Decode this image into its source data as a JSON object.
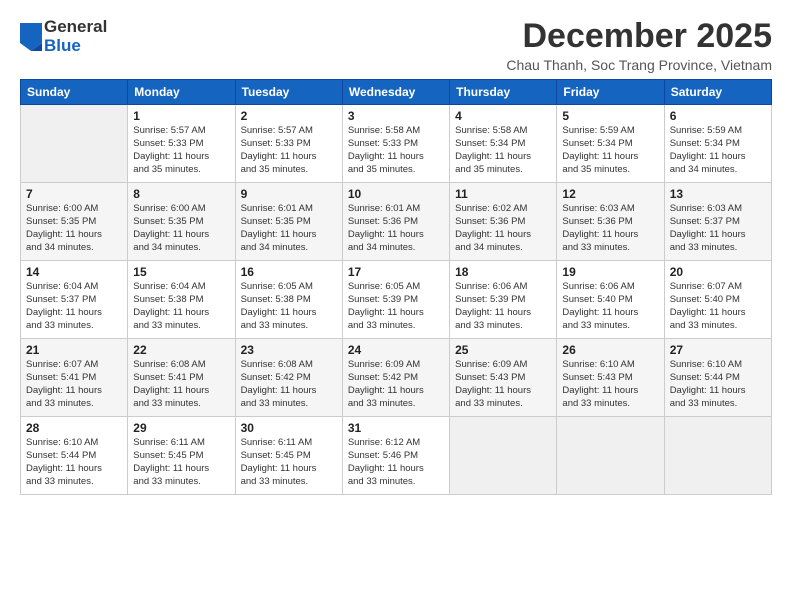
{
  "logo": {
    "general": "General",
    "blue": "Blue"
  },
  "header": {
    "month": "December 2025",
    "location": "Chau Thanh, Soc Trang Province, Vietnam"
  },
  "weekdays": [
    "Sunday",
    "Monday",
    "Tuesday",
    "Wednesday",
    "Thursday",
    "Friday",
    "Saturday"
  ],
  "weeks": [
    [
      {
        "day": "",
        "info": ""
      },
      {
        "day": "1",
        "info": "Sunrise: 5:57 AM\nSunset: 5:33 PM\nDaylight: 11 hours\nand 35 minutes."
      },
      {
        "day": "2",
        "info": "Sunrise: 5:57 AM\nSunset: 5:33 PM\nDaylight: 11 hours\nand 35 minutes."
      },
      {
        "day": "3",
        "info": "Sunrise: 5:58 AM\nSunset: 5:33 PM\nDaylight: 11 hours\nand 35 minutes."
      },
      {
        "day": "4",
        "info": "Sunrise: 5:58 AM\nSunset: 5:34 PM\nDaylight: 11 hours\nand 35 minutes."
      },
      {
        "day": "5",
        "info": "Sunrise: 5:59 AM\nSunset: 5:34 PM\nDaylight: 11 hours\nand 35 minutes."
      },
      {
        "day": "6",
        "info": "Sunrise: 5:59 AM\nSunset: 5:34 PM\nDaylight: 11 hours\nand 34 minutes."
      }
    ],
    [
      {
        "day": "7",
        "info": "Sunrise: 6:00 AM\nSunset: 5:35 PM\nDaylight: 11 hours\nand 34 minutes."
      },
      {
        "day": "8",
        "info": "Sunrise: 6:00 AM\nSunset: 5:35 PM\nDaylight: 11 hours\nand 34 minutes."
      },
      {
        "day": "9",
        "info": "Sunrise: 6:01 AM\nSunset: 5:35 PM\nDaylight: 11 hours\nand 34 minutes."
      },
      {
        "day": "10",
        "info": "Sunrise: 6:01 AM\nSunset: 5:36 PM\nDaylight: 11 hours\nand 34 minutes."
      },
      {
        "day": "11",
        "info": "Sunrise: 6:02 AM\nSunset: 5:36 PM\nDaylight: 11 hours\nand 34 minutes."
      },
      {
        "day": "12",
        "info": "Sunrise: 6:03 AM\nSunset: 5:36 PM\nDaylight: 11 hours\nand 33 minutes."
      },
      {
        "day": "13",
        "info": "Sunrise: 6:03 AM\nSunset: 5:37 PM\nDaylight: 11 hours\nand 33 minutes."
      }
    ],
    [
      {
        "day": "14",
        "info": "Sunrise: 6:04 AM\nSunset: 5:37 PM\nDaylight: 11 hours\nand 33 minutes."
      },
      {
        "day": "15",
        "info": "Sunrise: 6:04 AM\nSunset: 5:38 PM\nDaylight: 11 hours\nand 33 minutes."
      },
      {
        "day": "16",
        "info": "Sunrise: 6:05 AM\nSunset: 5:38 PM\nDaylight: 11 hours\nand 33 minutes."
      },
      {
        "day": "17",
        "info": "Sunrise: 6:05 AM\nSunset: 5:39 PM\nDaylight: 11 hours\nand 33 minutes."
      },
      {
        "day": "18",
        "info": "Sunrise: 6:06 AM\nSunset: 5:39 PM\nDaylight: 11 hours\nand 33 minutes."
      },
      {
        "day": "19",
        "info": "Sunrise: 6:06 AM\nSunset: 5:40 PM\nDaylight: 11 hours\nand 33 minutes."
      },
      {
        "day": "20",
        "info": "Sunrise: 6:07 AM\nSunset: 5:40 PM\nDaylight: 11 hours\nand 33 minutes."
      }
    ],
    [
      {
        "day": "21",
        "info": "Sunrise: 6:07 AM\nSunset: 5:41 PM\nDaylight: 11 hours\nand 33 minutes."
      },
      {
        "day": "22",
        "info": "Sunrise: 6:08 AM\nSunset: 5:41 PM\nDaylight: 11 hours\nand 33 minutes."
      },
      {
        "day": "23",
        "info": "Sunrise: 6:08 AM\nSunset: 5:42 PM\nDaylight: 11 hours\nand 33 minutes."
      },
      {
        "day": "24",
        "info": "Sunrise: 6:09 AM\nSunset: 5:42 PM\nDaylight: 11 hours\nand 33 minutes."
      },
      {
        "day": "25",
        "info": "Sunrise: 6:09 AM\nSunset: 5:43 PM\nDaylight: 11 hours\nand 33 minutes."
      },
      {
        "day": "26",
        "info": "Sunrise: 6:10 AM\nSunset: 5:43 PM\nDaylight: 11 hours\nand 33 minutes."
      },
      {
        "day": "27",
        "info": "Sunrise: 6:10 AM\nSunset: 5:44 PM\nDaylight: 11 hours\nand 33 minutes."
      }
    ],
    [
      {
        "day": "28",
        "info": "Sunrise: 6:10 AM\nSunset: 5:44 PM\nDaylight: 11 hours\nand 33 minutes."
      },
      {
        "day": "29",
        "info": "Sunrise: 6:11 AM\nSunset: 5:45 PM\nDaylight: 11 hours\nand 33 minutes."
      },
      {
        "day": "30",
        "info": "Sunrise: 6:11 AM\nSunset: 5:45 PM\nDaylight: 11 hours\nand 33 minutes."
      },
      {
        "day": "31",
        "info": "Sunrise: 6:12 AM\nSunset: 5:46 PM\nDaylight: 11 hours\nand 33 minutes."
      },
      {
        "day": "",
        "info": ""
      },
      {
        "day": "",
        "info": ""
      },
      {
        "day": "",
        "info": ""
      }
    ]
  ]
}
